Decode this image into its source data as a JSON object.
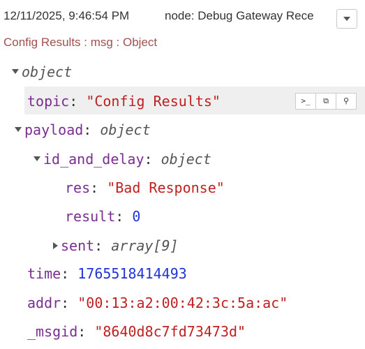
{
  "header": {
    "timestamp": "12/11/2025, 9:46:54 PM",
    "node": "node: Debug Gateway Rece",
    "meta": "Config Results : msg : Object"
  },
  "tree": {
    "root_type": "object",
    "topic_key": "topic",
    "topic_value": "\"Config Results\"",
    "payload_key": "payload",
    "payload_type": "object",
    "id_and_delay_key": "id_and_delay",
    "id_and_delay_type": "object",
    "res_key": "res",
    "res_value": "\"Bad Response\"",
    "result_key": "result",
    "result_value": "0",
    "sent_key": "sent",
    "sent_type": "array[9]",
    "time_key": "time",
    "time_value": "1765518414493",
    "addr_key": "addr",
    "addr_value": "\"00:13:a2:00:42:3c:5a:ac\"",
    "msgid_key": "_msgid",
    "msgid_value": "\"8640d8c7fd73473d\""
  },
  "toolbar": {
    "copy_path_icon": ">_",
    "copy_value_icon": "⧉",
    "pin_icon": "⚲"
  },
  "colors": {
    "key": "#792e90",
    "string": "#c02020",
    "number": "#2033d6",
    "meta": "#a05050",
    "highlight": "#efefef"
  }
}
